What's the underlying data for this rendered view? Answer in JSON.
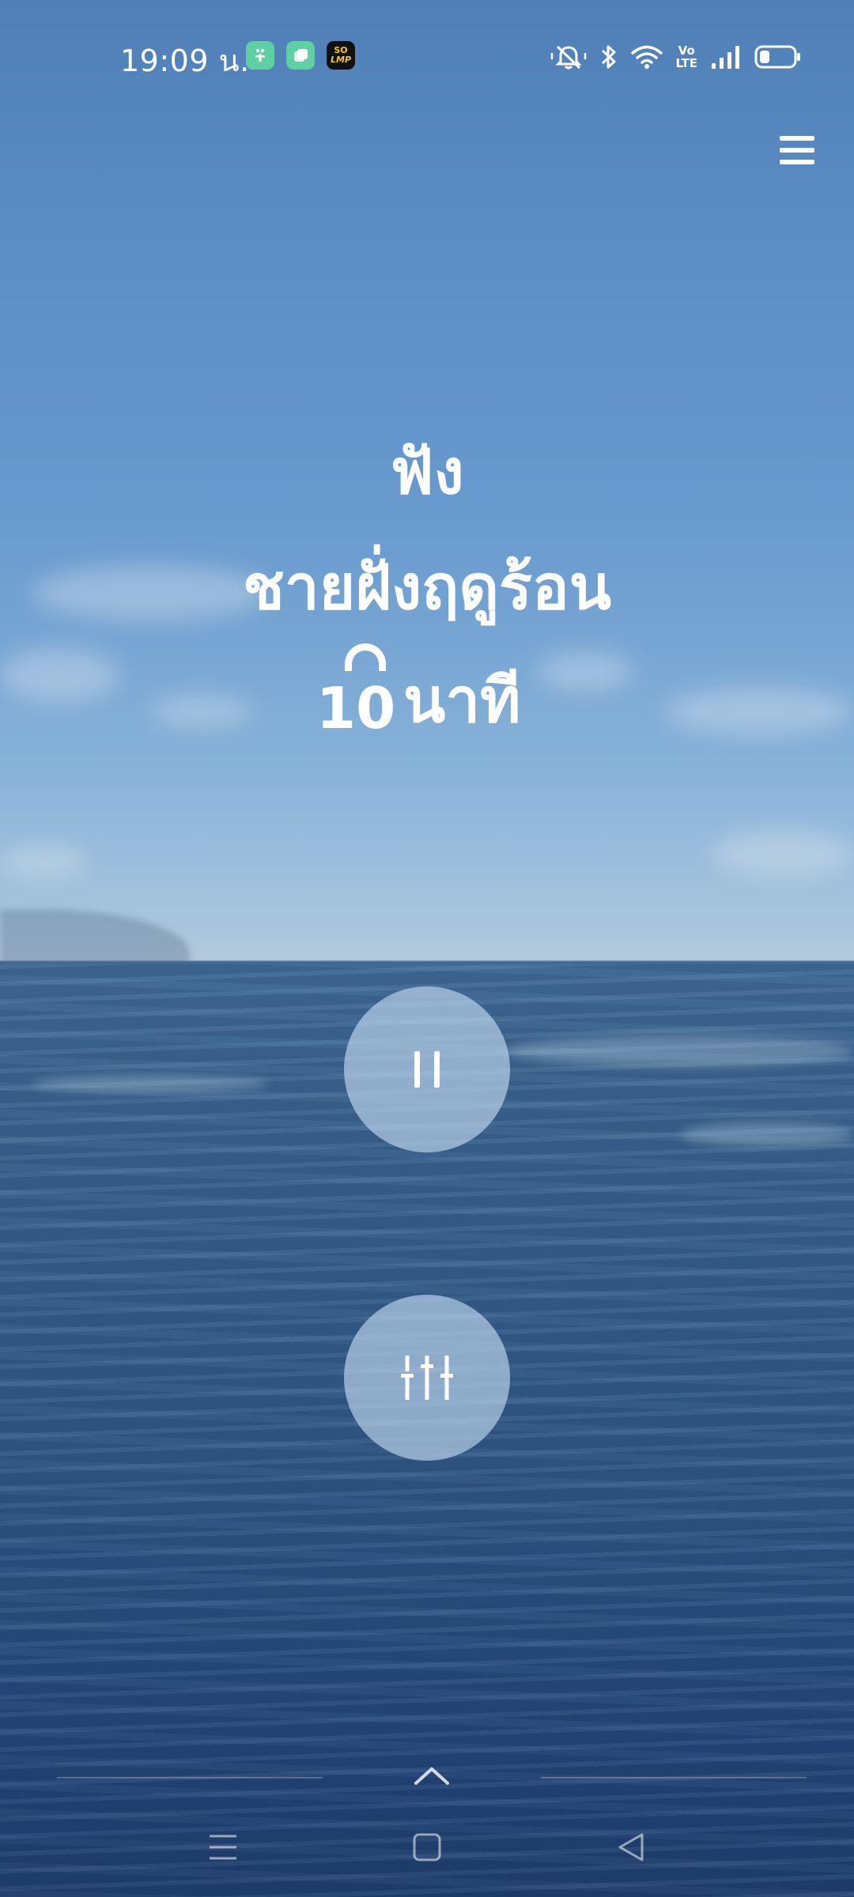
{
  "status_bar": {
    "time": "19:09 น.",
    "apps": [
      {
        "icon": "fitness-app-icon",
        "color": "#5fcfa4"
      },
      {
        "icon": "chat-app-icon",
        "color": "#5fcfa4"
      },
      {
        "icon": "solmp-app-icon",
        "label": "SO\nLMP",
        "color": "#111111"
      }
    ],
    "icons": [
      "mute-icon",
      "bluetooth-icon",
      "wifi-icon",
      "volte-icon",
      "signal-icon",
      "battery-icon"
    ],
    "volte_label_1": "Vo",
    "volte_label_2": "LTE",
    "battery_level": 0.3
  },
  "header": {
    "menu_icon": "hamburger-menu-icon"
  },
  "session": {
    "line1": "ฟัง",
    "line2": "ชายฝั่งฤดูร้อน",
    "duration_value": "10",
    "duration_unit": "นาที"
  },
  "controls": {
    "pause_icon": "pause-icon",
    "mixer_icon": "sliders-icon"
  },
  "nav": {
    "buttons": [
      "recent-apps-icon",
      "home-icon",
      "back-icon"
    ]
  },
  "colors": {
    "sky_top": "#4f7fb6",
    "horizon": "#b3cadb",
    "sea": "#2d5584",
    "button_fill": "#c8def5"
  }
}
